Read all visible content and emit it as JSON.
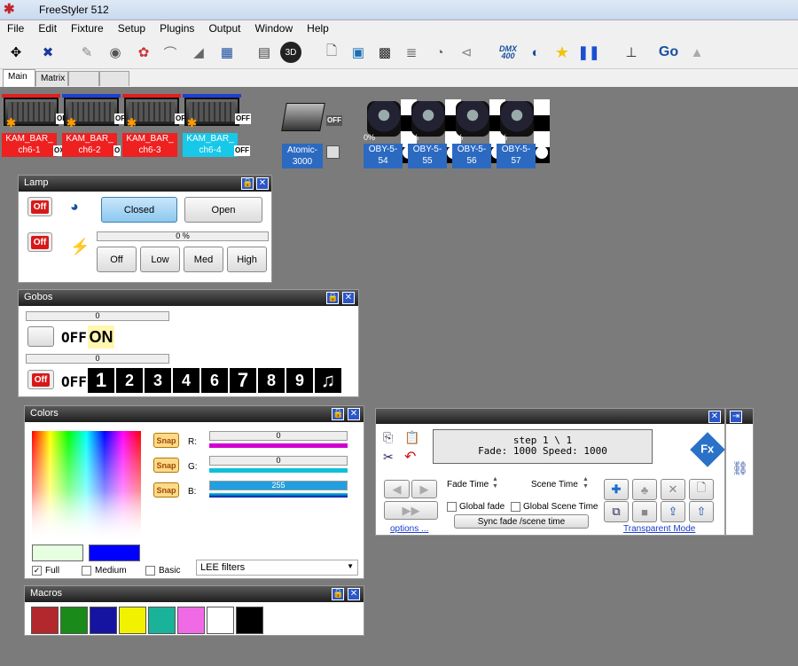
{
  "app": {
    "title": "FreeStyler 512"
  },
  "menu": [
    "File",
    "Edit",
    "Fixture",
    "Setup",
    "Plugins",
    "Output",
    "Window",
    "Help"
  ],
  "toolbar": {
    "dmx_label": "DMX",
    "dmx_sub": "400",
    "go_label": "Go"
  },
  "tabs": [
    "Main",
    "Matrix",
    "",
    ""
  ],
  "fixtures": {
    "bars": [
      {
        "name": "KAM_BAR_",
        "sub": "ch6-1",
        "off": "OFF",
        "off2": "OF"
      },
      {
        "name": "KAM_BAR_",
        "sub": "ch6-2",
        "off": "OFF",
        "off2": "O"
      },
      {
        "name": "KAM_BAR_",
        "sub": "ch6-3",
        "off": "OFF",
        "off2": "O"
      },
      {
        "name": "KAM_BAR_",
        "sub": "ch6-4",
        "off": "OFF",
        "off2": "OFF"
      }
    ],
    "atomic": {
      "name": "Atomic-",
      "sub": "3000",
      "off": "OFF"
    },
    "heads": [
      {
        "name": "OBY-5-",
        "sub": "54",
        "pct": "0%"
      },
      {
        "name": "OBY-5-",
        "sub": "55",
        "pct": "%"
      },
      {
        "name": "OBY-5-",
        "sub": "56",
        "pct": "%"
      },
      {
        "name": "OBY-5-",
        "sub": "57",
        "pct": "%"
      }
    ]
  },
  "lamp": {
    "title": "Lamp",
    "off1": "Off",
    "off2": "Off",
    "closed": "Closed",
    "open": "Open",
    "level": "0 %",
    "levels": [
      "Off",
      "Low",
      "Med",
      "High"
    ]
  },
  "gobos": {
    "title": "Gobos",
    "val1": "0",
    "val2": "0",
    "off_label": "OFF",
    "on_label": "ON",
    "off_btn": "Off",
    "off_label2": "OFF",
    "numbers": [
      "1",
      "2",
      "3",
      "4",
      "6",
      "7",
      "8",
      "9",
      "♫"
    ]
  },
  "colors": {
    "title": "Colors",
    "snap": "Snap",
    "r_label": "R:",
    "g_label": "G:",
    "b_label": "B:",
    "r_val": "0",
    "g_val": "0",
    "b_val": "255",
    "full": "Full",
    "medium": "Medium",
    "basic": "Basic",
    "filter": "LEE filters",
    "swatch1": "#e6ffe0",
    "swatch2": "#0000ff"
  },
  "macros": {
    "title": "Macros",
    "colors": [
      "#b3282d",
      "#1a8a1a",
      "#1414a0",
      "#f2f200",
      "#1ab39a",
      "#f06ae6",
      "#ffffff",
      "#000000"
    ]
  },
  "sequencer": {
    "step": "step  1 \\ 1",
    "fade_line": "Fade: 1000  Speed: 1000",
    "fade_time": "Fade Time",
    "scene_time": "Scene Time",
    "global_fade": "Global fade",
    "global_scene": "Global Scene Time",
    "sync": "Sync fade /scene time",
    "options": "options ...",
    "transparent": "Transparent Mode",
    "fx": "Fx"
  }
}
